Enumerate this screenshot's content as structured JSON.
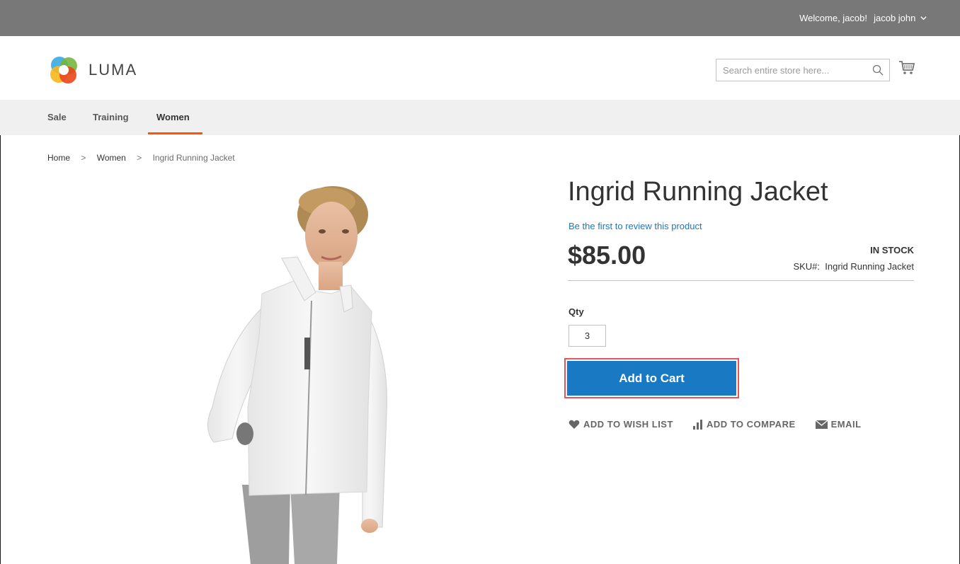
{
  "topbar": {
    "welcome": "Welcome, jacob!",
    "customer_name": "jacob john"
  },
  "header": {
    "logo_text": "LUMA",
    "search_placeholder": "Search entire store here...",
    "icons": [
      "luma-logo-icon",
      "search-icon",
      "cart-icon"
    ]
  },
  "nav": {
    "items": [
      {
        "label": "Sale"
      },
      {
        "label": "Training"
      },
      {
        "label": "Women",
        "active": true
      }
    ],
    "accent_color": "#ff5501"
  },
  "breadcrumb": {
    "home": "Home",
    "category": "Women",
    "separator": ">",
    "current": "Ingrid Running Jacket"
  },
  "product": {
    "title": "Ingrid Running Jacket",
    "review_link": "Be the first to review this product",
    "price": "$85.00",
    "stock": "IN STOCK",
    "sku_label": "SKU#:",
    "sku_value": "Ingrid Running Jacket",
    "qty_label": "Qty",
    "qty_value": "3",
    "add_to_cart": "Add to Cart",
    "button_color": "#1979c3",
    "highlight_color": "#e2555b"
  },
  "actions": {
    "wishlist": "ADD TO WISH LIST",
    "compare": "ADD TO COMPARE",
    "email": "EMAIL"
  }
}
